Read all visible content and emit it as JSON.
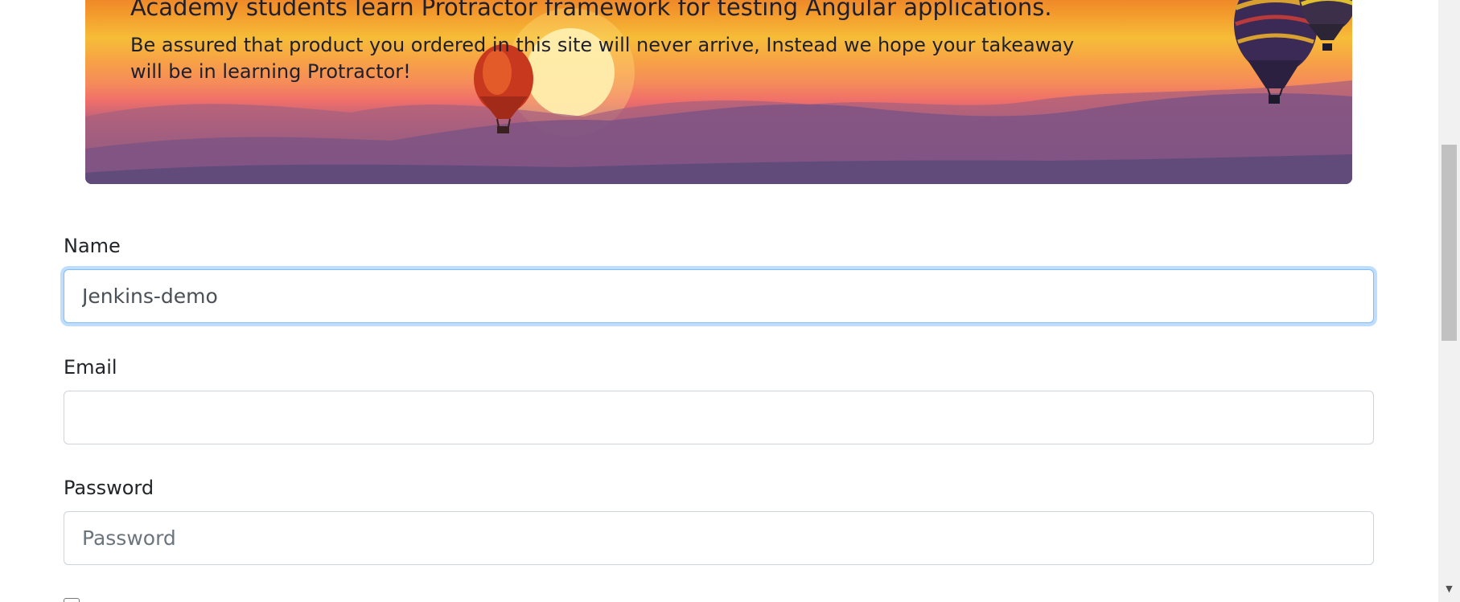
{
  "banner": {
    "title": "Academy students learn Protractor framework for testing Angular applications.",
    "text": "Be assured that product you ordered in this site will never arrive, Instead we hope your takeaway will be in learning Protractor!"
  },
  "form": {
    "name": {
      "label": "Name",
      "value": "Jenkins-demo",
      "placeholder": ""
    },
    "email": {
      "label": "Email",
      "value": "",
      "placeholder": ""
    },
    "password": {
      "label": "Password",
      "value": "",
      "placeholder": "Password"
    }
  },
  "colors": {
    "focus_border": "#80bdff",
    "input_border": "#ced4da"
  },
  "scrollbar": {
    "down_arrow": "▼"
  }
}
